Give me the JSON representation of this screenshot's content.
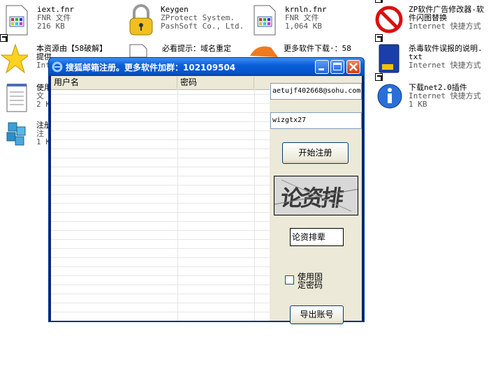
{
  "desktop": {
    "icons": [
      {
        "id": "iext",
        "name": "iext.fnr",
        "line2": "FNR 文件",
        "line3": "216 KB",
        "icon": "document-icon"
      },
      {
        "id": "keygen",
        "name": "Keygen",
        "line2": "ZProtect System.",
        "line3": "PashSoft Co., Ltd.",
        "icon": "padlock-icon"
      },
      {
        "id": "krnln",
        "name": "krnln.fnr",
        "line2": "FNR 文件",
        "line3": "1,064 KB",
        "icon": "document-icon"
      },
      {
        "id": "zp",
        "name": "ZP软件广告修改器-软",
        "name2": "件闪图替换",
        "line3": "Internet 快捷方式",
        "icon": "no-entry-icon"
      },
      {
        "id": "src58",
        "name": "本资源由【58破解】",
        "name2": "提供",
        "line3": "Int",
        "icon": "star-icon"
      },
      {
        "id": "domain",
        "name": "必看提示：域名重定",
        "icon": "document-icon"
      },
      {
        "id": "more58",
        "name": "更多软件下载·：58",
        "icon": "browser-icon"
      },
      {
        "id": "av",
        "name": "杀毒软件误报的说明.",
        "name2": "txt",
        "line3": "Internet 快捷方式",
        "icon": "book-icon"
      },
      {
        "id": "use",
        "name": "使用",
        "line2": "文",
        "line3": "2 K",
        "icon": "notepad-icon"
      },
      {
        "id": "net2",
        "name": "下载net2.0插件",
        "line2": "Internet 快捷方式",
        "line3": "1 KB",
        "icon": "info-icon"
      },
      {
        "id": "reg",
        "name": "注册",
        "line2": "注",
        "line3": "1 K",
        "icon": "registry-icon"
      }
    ]
  },
  "window": {
    "title": "搜狐邮箱注册。更多软件加群：102109504",
    "columns": [
      "用户名",
      "密码"
    ],
    "email_value": "aetujf402668@sohu.com",
    "password_value": "wizgtx27",
    "start_button": "开始注册",
    "captcha_text": "论资排辈",
    "captcha_input": "论资排辈",
    "checkbox_label_1": "使用固",
    "checkbox_label_2": "定密码",
    "export_button": "导出账号"
  },
  "colors": {
    "titlebar": "#0a5fdb",
    "window_face": "#ece9d8",
    "close_button": "#d23b10"
  }
}
